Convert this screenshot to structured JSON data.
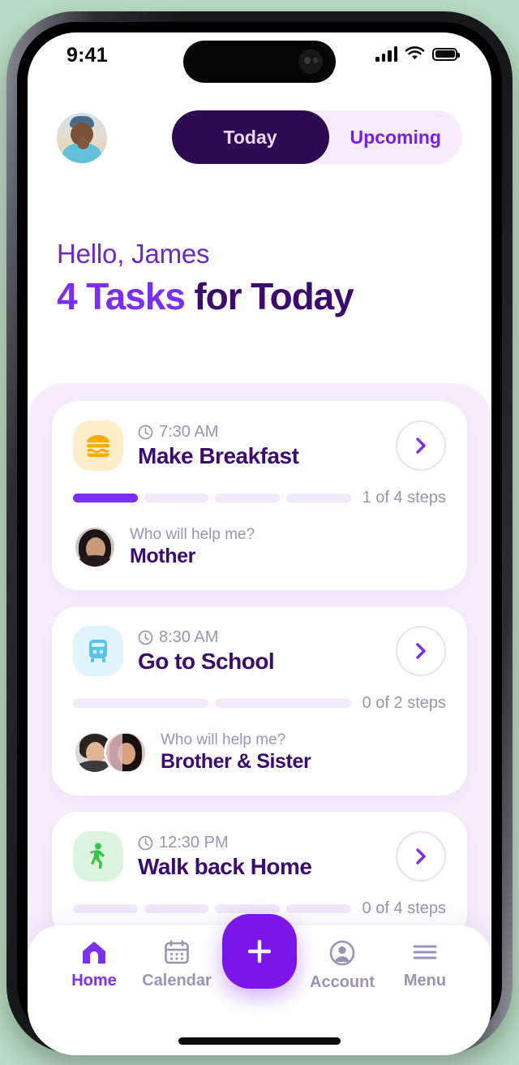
{
  "status_bar": {
    "time": "9:41",
    "signal_icon": "cellular-signal-icon",
    "wifi_icon": "wifi-icon",
    "battery_icon": "battery-icon"
  },
  "header": {
    "avatar_name": "profile-avatar",
    "tabs": [
      {
        "label": "Today",
        "active": true
      },
      {
        "label": "Upcoming",
        "active": false
      }
    ]
  },
  "greeting": {
    "hello": "Hello, James",
    "count": "4 Tasks",
    "rest": " for Today"
  },
  "tasks": [
    {
      "time": "7:30 AM",
      "title": "Make Breakfast",
      "icon": "hamburger-icon",
      "steps_done": 1,
      "steps_total": 4,
      "steps_label": "1 of  4 steps",
      "helper_question": "Who will help me?",
      "helper_name": "Mother",
      "helper_count": 1
    },
    {
      "time": "8:30 AM",
      "title": "Go to School",
      "icon": "bus-icon",
      "steps_done": 0,
      "steps_total": 2,
      "steps_label": "0 of  2 steps",
      "helper_question": "Who will help me?",
      "helper_name": "Brother & Sister",
      "helper_count": 2
    },
    {
      "time": "12:30 PM",
      "title": "Walk back Home",
      "icon": "walking-person-icon",
      "steps_done": 0,
      "steps_total": 4,
      "steps_label": "0 of  4 steps",
      "helper_question": "",
      "helper_name": "",
      "helper_count": 0
    }
  ],
  "bottom_nav": {
    "items": [
      {
        "label": "Home",
        "icon": "home-icon",
        "active": true
      },
      {
        "label": "Calendar",
        "icon": "calendar-icon",
        "active": false
      },
      {
        "label": "Account",
        "icon": "account-icon",
        "active": false
      },
      {
        "label": "Menu",
        "icon": "menu-icon",
        "active": false
      }
    ],
    "fab_icon": "plus-icon"
  },
  "colors": {
    "accent_purple": "#7b2ff2",
    "fab_purple": "#7b16e8",
    "dark_purple": "#3b0b6e",
    "tab_active_bg": "#2d0a52",
    "panel_bg": "#f7edfd",
    "muted_text": "#9d93b5",
    "breakfast_tile": "#fdeec9",
    "school_tile": "#e1f3fc",
    "walk_tile": "#dcf5de"
  }
}
